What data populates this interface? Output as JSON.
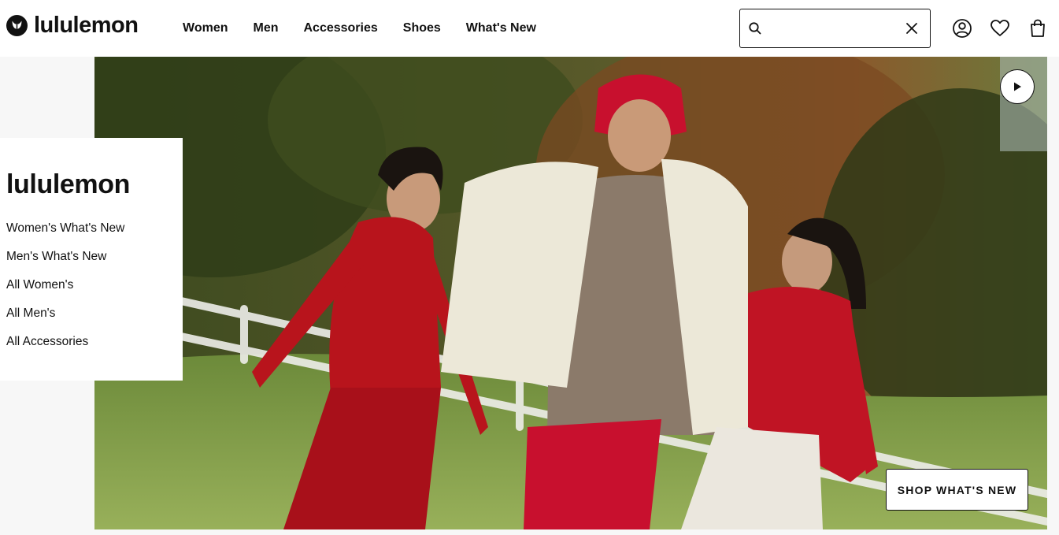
{
  "header": {
    "brand": "lululemon",
    "nav": [
      "Women",
      "Men",
      "Accessories",
      "Shoes",
      "What's New"
    ],
    "search": {
      "value": "",
      "placeholder": ""
    },
    "icons": [
      "search-icon",
      "close-icon",
      "account-icon",
      "heart-icon",
      "shopping-bag-icon"
    ]
  },
  "side_panel": {
    "title": "lululemon",
    "links": [
      "Women's What's New",
      "Men's What's New",
      "All Women's",
      "All Men's",
      "All Accessories"
    ]
  },
  "hero": {
    "cta_label": "SHOP WHAT'S NEW",
    "play_icon": "play-icon",
    "colors": {
      "accent_red": "#c8102e",
      "grass": "#7d9a4a",
      "trees": "#4a5a2c"
    }
  }
}
